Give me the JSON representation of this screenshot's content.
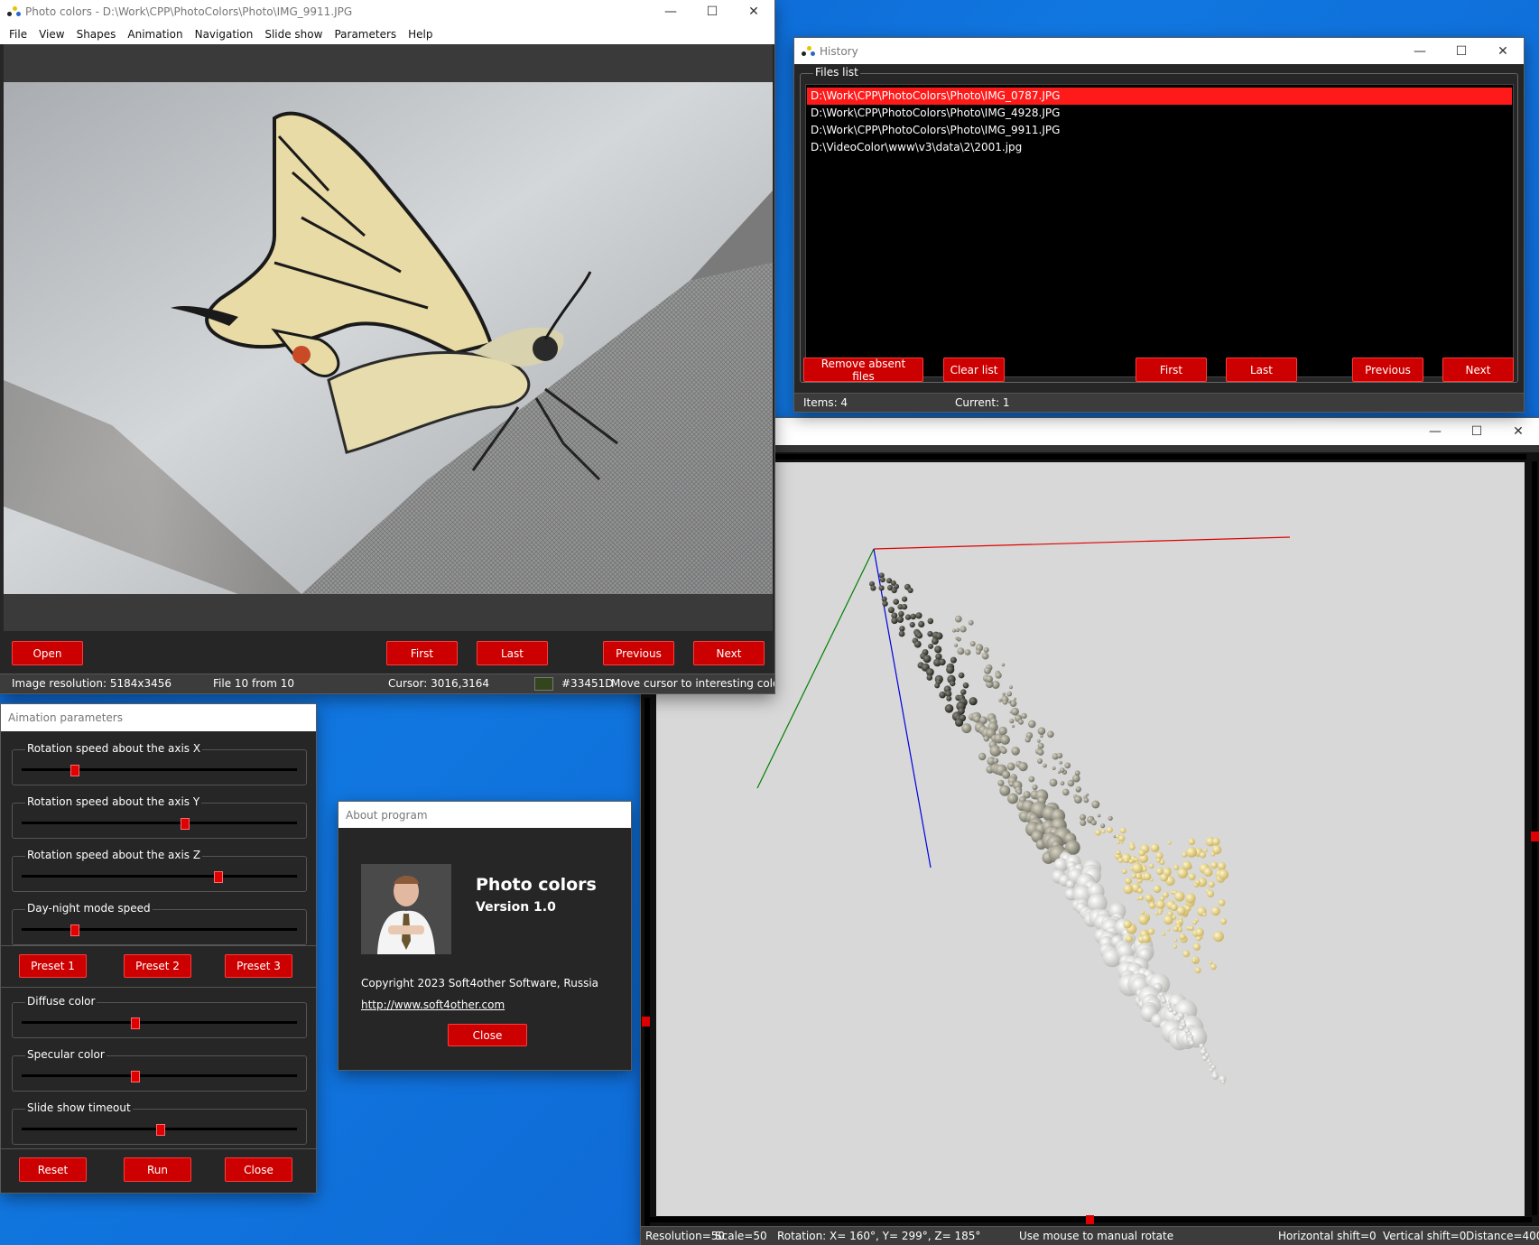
{
  "main_window": {
    "title": "Photo colors - D:\\Work\\CPP\\PhotoColors\\Photo\\IMG_9911.JPG",
    "menu": [
      "File",
      "View",
      "Shapes",
      "Animation",
      "Navigation",
      "Slide show",
      "Parameters",
      "Help"
    ],
    "buttons": {
      "open": "Open",
      "first": "First",
      "last": "Last",
      "previous": "Previous",
      "next": "Next"
    },
    "status": {
      "resolution": "Image resolution: 5184x3456",
      "file": "File 10 from 10",
      "cursor": "Cursor: 3016,3164",
      "color_hex": "#33451D",
      "swatch_color": "#33451D",
      "hint": "Move cursor to interesting color to"
    }
  },
  "history_window": {
    "title": "History",
    "group_label": "Files list",
    "files": [
      "D:\\Work\\CPP\\PhotoColors\\Photo\\IMG_0787.JPG",
      "D:\\Work\\CPP\\PhotoColors\\Photo\\IMG_4928.JPG",
      "D:\\Work\\CPP\\PhotoColors\\Photo\\IMG_9911.JPG",
      "D:\\VideoColor\\www\\v3\\data\\2\\2001.jpg"
    ],
    "selected_index": 0,
    "buttons": {
      "remove": "Remove absent files",
      "clear": "Clear list",
      "first": "First",
      "last": "Last",
      "previous": "Previous",
      "next": "Next"
    },
    "status": {
      "items": "Items: 4",
      "current": "Current: 1"
    }
  },
  "view3d_window": {
    "status": {
      "resolution": "Resolution=50",
      "scale": "Scale=50",
      "rotation": "Rotation: X= 160°, Y= 299°, Z= 185°",
      "hint": "Use mouse to manual rotate",
      "hshift": "Horizontal shift=0",
      "vshift": "Vertical shift=0",
      "distance": "Distance=400"
    },
    "axis_colors": {
      "x": "#e00000",
      "y": "#008000",
      "z": "#0000e0"
    }
  },
  "animation_window": {
    "title": "Aimation parameters",
    "sliders": [
      {
        "label": "Rotation speed about the axis X",
        "value": 0.19
      },
      {
        "label": "Rotation speed about the axis Y",
        "value": 0.59
      },
      {
        "label": "Rotation speed about the axis Z",
        "value": 0.71
      },
      {
        "label": "Day-night mode speed",
        "value": 0.19
      }
    ],
    "presets": [
      "Preset 1",
      "Preset 2",
      "Preset 3"
    ],
    "sliders2": [
      {
        "label": "Diffuse color",
        "value": 0.41
      },
      {
        "label": "Specular color",
        "value": 0.41
      },
      {
        "label": "Slide show timeout",
        "value": 0.5
      }
    ],
    "buttons": {
      "reset": "Reset",
      "run": "Run",
      "close": "Close"
    }
  },
  "about_window": {
    "title": "About program",
    "app_name": "Photo colors",
    "version": "Version 1.0",
    "copyright": "Copyright 2023 Soft4other Software, Russia",
    "link": "http://www.soft4other.com",
    "close": "Close"
  },
  "accent_color": "#cc0000"
}
